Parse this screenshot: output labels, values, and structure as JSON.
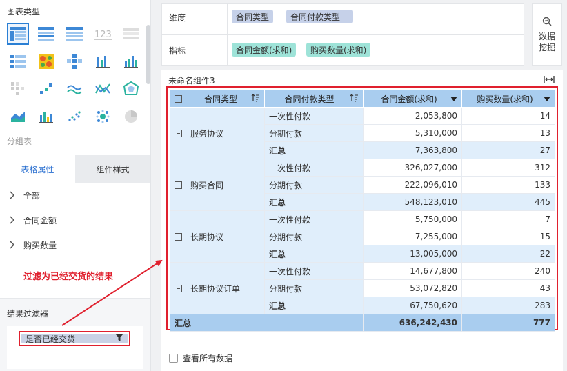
{
  "left_panel": {
    "chart_type_title": "图表类型",
    "chart_types": [
      "cross-table-icon",
      "group-table-icon",
      "detail-table-icon",
      "kpi-number-icon",
      "list-table-icon",
      "list-chart-icon",
      "heatmap-icon",
      "multi-table-icon",
      "bar-chart-icon",
      "column-chart-icon",
      "dot-grid-icon",
      "stair-chart-icon",
      "line-chart-icon",
      "radar-line-icon",
      "radar-chart-icon",
      "area-chart-icon",
      "combo-chart-icon",
      "scatter-chart-icon",
      "bubble-chart-icon",
      "pie-chart-icon"
    ],
    "group_table_label": "分组表",
    "tabs": [
      {
        "label": "表格属性",
        "active": true
      },
      {
        "label": "组件样式",
        "active": false
      }
    ],
    "properties": [
      "全部",
      "合同金额",
      "购买数量"
    ],
    "result_filter_title": "结果过滤器",
    "filter_chip": "是否已经交货"
  },
  "annotation": {
    "text": "过滤为已经交货的结果",
    "color": "#e0202e"
  },
  "dimension": {
    "label": "维度",
    "items": [
      "合同类型",
      "合同付款类型"
    ]
  },
  "metric": {
    "label": "指标",
    "items": [
      "合同金额(求和)",
      "购买数量(求和)"
    ]
  },
  "mining": {
    "label": "数据挖掘"
  },
  "widget": {
    "name": "未命名组件3"
  },
  "table": {
    "headers": [
      "合同类型",
      "合同付款类型",
      "合同金额(求和)",
      "购买数量(求和)"
    ],
    "groups": [
      {
        "name": "服务协议",
        "rows": [
          {
            "type": "一次性付款",
            "amount": "2,053,800",
            "qty": "14"
          },
          {
            "type": "分期付款",
            "amount": "5,310,000",
            "qty": "13"
          }
        ],
        "total": {
          "label": "汇总",
          "amount": "7,363,800",
          "qty": "27"
        }
      },
      {
        "name": "购买合同",
        "rows": [
          {
            "type": "一次性付款",
            "amount": "326,027,000",
            "qty": "312"
          },
          {
            "type": "分期付款",
            "amount": "222,096,010",
            "qty": "133"
          }
        ],
        "total": {
          "label": "汇总",
          "amount": "548,123,010",
          "qty": "445"
        }
      },
      {
        "name": "长期协议",
        "rows": [
          {
            "type": "一次性付款",
            "amount": "5,750,000",
            "qty": "7"
          },
          {
            "type": "分期付款",
            "amount": "7,255,000",
            "qty": "15"
          }
        ],
        "total": {
          "label": "汇总",
          "amount": "13,005,000",
          "qty": "22"
        }
      },
      {
        "name": "长期协议订单",
        "rows": [
          {
            "type": "一次性付款",
            "amount": "14,677,800",
            "qty": "240"
          },
          {
            "type": "分期付款",
            "amount": "53,072,820",
            "qty": "43"
          }
        ],
        "total": {
          "label": "汇总",
          "amount": "67,750,620",
          "qty": "283"
        }
      }
    ],
    "grand_total": {
      "label": "汇总",
      "amount": "636,242,430",
      "qty": "777"
    }
  },
  "view_all": {
    "label": "查看所有数据",
    "checked": false
  },
  "colors": {
    "accent": "#2a7fd4",
    "header_blue": "#a9cdef",
    "row_blue": "#e0eefb",
    "dimension_chip": "#c6d1e9",
    "metric_chip": "#9ee3d8",
    "highlight_red": "#e0202e"
  }
}
